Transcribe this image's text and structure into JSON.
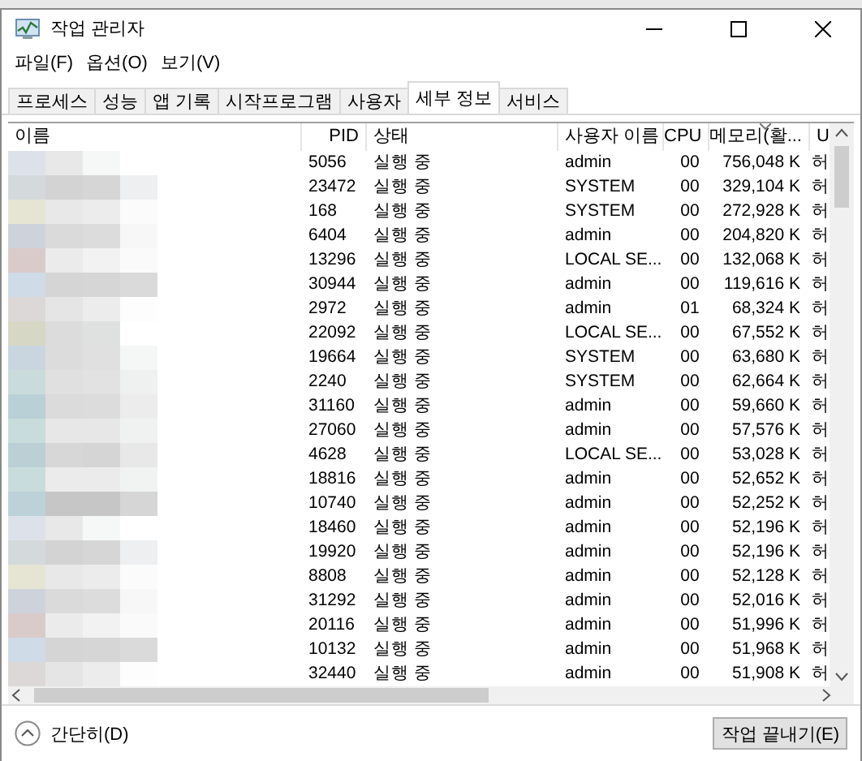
{
  "window": {
    "title": "작업 관리자"
  },
  "menu": [
    "파일(F)",
    "옵션(O)",
    "보기(V)"
  ],
  "tabs": [
    {
      "label": "프로세스",
      "selected": false
    },
    {
      "label": "성능",
      "selected": false
    },
    {
      "label": "앱 기록",
      "selected": false
    },
    {
      "label": "시작프로그램",
      "selected": false
    },
    {
      "label": "사용자",
      "selected": false
    },
    {
      "label": "세부 정보",
      "selected": true
    },
    {
      "label": "서비스",
      "selected": false
    }
  ],
  "table": {
    "columns": [
      {
        "label": "이름",
        "sorted": false
      },
      {
        "label": "PID",
        "sorted": false
      },
      {
        "label": "상태",
        "sorted": false
      },
      {
        "label": "사용자 이름",
        "sorted": false
      },
      {
        "label": "CPU",
        "sorted": false
      },
      {
        "label": "메모리(활...",
        "sorted": true
      },
      {
        "label": "U",
        "sorted": false
      }
    ],
    "rows": [
      {
        "pid": "5056",
        "status": "실행 중",
        "user": "admin",
        "cpu": "00",
        "memory": "756,048 K",
        "uac": "허"
      },
      {
        "pid": "23472",
        "status": "실행 중",
        "user": "SYSTEM",
        "cpu": "00",
        "memory": "329,104 K",
        "uac": "허"
      },
      {
        "pid": "168",
        "status": "실행 중",
        "user": "SYSTEM",
        "cpu": "00",
        "memory": "272,928 K",
        "uac": "허"
      },
      {
        "pid": "6404",
        "status": "실행 중",
        "user": "admin",
        "cpu": "00",
        "memory": "204,820 K",
        "uac": "허"
      },
      {
        "pid": "13296",
        "status": "실행 중",
        "user": "LOCAL SE...",
        "cpu": "00",
        "memory": "132,068 K",
        "uac": "허"
      },
      {
        "pid": "30944",
        "status": "실행 중",
        "user": "admin",
        "cpu": "00",
        "memory": "119,616 K",
        "uac": "허"
      },
      {
        "pid": "2972",
        "status": "실행 중",
        "user": "admin",
        "cpu": "01",
        "memory": "68,324 K",
        "uac": "허"
      },
      {
        "pid": "22092",
        "status": "실행 중",
        "user": "LOCAL SE...",
        "cpu": "00",
        "memory": "67,552 K",
        "uac": "허"
      },
      {
        "pid": "19664",
        "status": "실행 중",
        "user": "SYSTEM",
        "cpu": "00",
        "memory": "63,680 K",
        "uac": "허"
      },
      {
        "pid": "2240",
        "status": "실행 중",
        "user": "SYSTEM",
        "cpu": "00",
        "memory": "62,664 K",
        "uac": "허"
      },
      {
        "pid": "31160",
        "status": "실행 중",
        "user": "admin",
        "cpu": "00",
        "memory": "59,660 K",
        "uac": "허"
      },
      {
        "pid": "27060",
        "status": "실행 중",
        "user": "admin",
        "cpu": "00",
        "memory": "57,576 K",
        "uac": "허"
      },
      {
        "pid": "4628",
        "status": "실행 중",
        "user": "LOCAL SE...",
        "cpu": "00",
        "memory": "53,028 K",
        "uac": "허"
      },
      {
        "pid": "18816",
        "status": "실행 중",
        "user": "admin",
        "cpu": "00",
        "memory": "52,652 K",
        "uac": "허"
      },
      {
        "pid": "10740",
        "status": "실행 중",
        "user": "admin",
        "cpu": "00",
        "memory": "52,252 K",
        "uac": "허"
      },
      {
        "pid": "18460",
        "status": "실행 중",
        "user": "admin",
        "cpu": "00",
        "memory": "52,196 K",
        "uac": "허"
      },
      {
        "pid": "19920",
        "status": "실행 중",
        "user": "admin",
        "cpu": "00",
        "memory": "52,196 K",
        "uac": "허"
      },
      {
        "pid": "8808",
        "status": "실행 중",
        "user": "admin",
        "cpu": "00",
        "memory": "52,128 K",
        "uac": "허"
      },
      {
        "pid": "31292",
        "status": "실행 중",
        "user": "admin",
        "cpu": "00",
        "memory": "52,016 K",
        "uac": "허"
      },
      {
        "pid": "20116",
        "status": "실행 중",
        "user": "admin",
        "cpu": "00",
        "memory": "51,996 K",
        "uac": "허"
      },
      {
        "pid": "10132",
        "status": "실행 중",
        "user": "admin",
        "cpu": "00",
        "memory": "51,968 K",
        "uac": "허"
      },
      {
        "pid": "32440",
        "status": "실행 중",
        "user": "admin",
        "cpu": "00",
        "memory": "51,908 K",
        "uac": "허"
      }
    ]
  },
  "footer": {
    "collapse": "간단히(D)",
    "end_task": "작업 끝내기(E)"
  }
}
